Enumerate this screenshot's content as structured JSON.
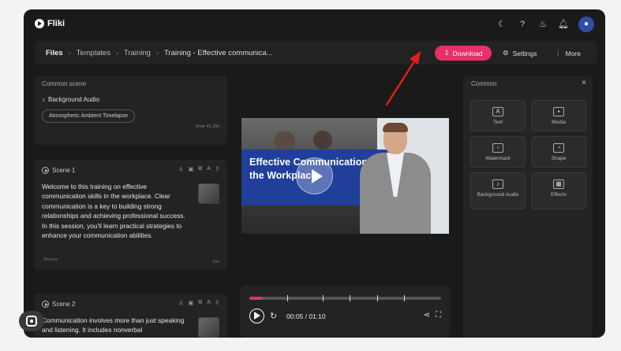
{
  "app": {
    "name": "Fliki"
  },
  "topbar": {
    "icons": [
      "moon-icon",
      "help-icon",
      "flame-icon",
      "bell-icon",
      "user-icon"
    ]
  },
  "breadcrumb": [
    "Files",
    "Templates",
    "Training",
    "Training - Effective communica..."
  ],
  "actions": {
    "download": "Download",
    "settings": "Settings",
    "more": "More"
  },
  "common_scene": {
    "title": "Common scene",
    "audio_label": "Background Audio",
    "audio_track": "Atmospheric Ambient Timelapse",
    "duration": "2min 41.29s"
  },
  "scenes": [
    {
      "label": "Scene 1",
      "text": "Welcome to this training on effective communication skills in the workplace. Clear communication is a key to building strong relationships and achieving professional success. In this session, you'll learn practical strategies to enhance your communication abilities.",
      "author": "Marcus",
      "time": "15s"
    },
    {
      "label": "Scene 2",
      "text": "Communication involves more than just speaking and listening. It includes nonverbal"
    }
  ],
  "preview": {
    "title": "Effective Communication in the Workplace"
  },
  "player": {
    "time": "00:05 / 01:10",
    "progress": 0.07
  },
  "right_panel": {
    "title": "Common",
    "tiles": [
      {
        "label": "Text",
        "icon": "text-icon"
      },
      {
        "label": "Media",
        "icon": "image-icon"
      },
      {
        "label": "Watermark",
        "icon": "watermark-icon"
      },
      {
        "label": "Shape",
        "icon": "shape-icon"
      },
      {
        "label": "Background Audio",
        "icon": "music-icon"
      },
      {
        "label": "Effects",
        "icon": "effects-icon"
      }
    ]
  },
  "colors": {
    "accent": "#e7306a",
    "panel": "#232323",
    "window": "#1a1a1a",
    "banner": "#1f3f9a",
    "arrow": "#e11d1d"
  }
}
